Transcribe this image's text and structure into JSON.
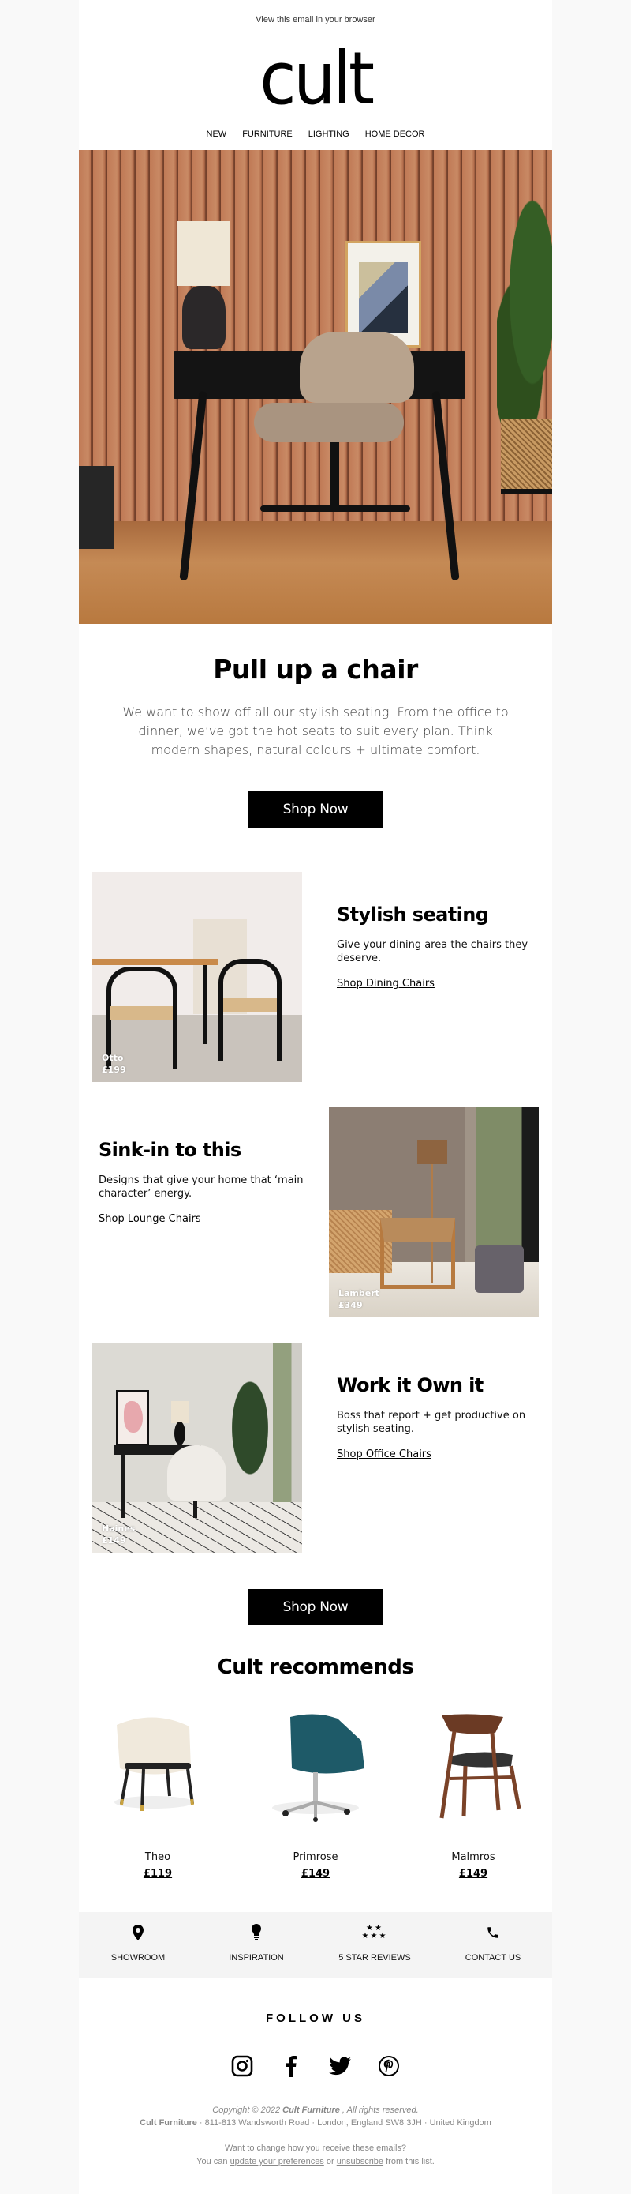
{
  "preheader": {
    "view_in_browser": "View this email in your browser"
  },
  "brand": {
    "logo_text": "cult"
  },
  "nav": {
    "items": [
      "NEW",
      "FURNITURE",
      "LIGHTING",
      "HOME DECOR"
    ]
  },
  "hero": {
    "alt": "Boucle office chair at black desk against wooden slat wall"
  },
  "intro": {
    "heading": "Pull up a chair",
    "body": "We want to show off all our stylish seating. From the office to dinner, we’ve got the hot seats to suit every plan. Think modern shapes, natural colours + ultimate comfort.",
    "cta": "Shop Now"
  },
  "features": [
    {
      "heading": "Stylish seating",
      "body": "Give your dining area the chairs they deserve.",
      "link": "Shop Dining Chairs",
      "product_name": "Otto",
      "product_price": "£199"
    },
    {
      "heading": "Sink-in to this",
      "body": "Designs that give your home that ‘main character’ energy.",
      "link": "Shop Lounge Chairs",
      "product_name": "Lambert",
      "product_price": "£349"
    },
    {
      "heading": "Work it Own it",
      "body": "Boss that report + get productive on stylish seating.",
      "link": "Shop Office Chairs",
      "product_name": "Haines",
      "product_price": "£149"
    }
  ],
  "cta2": {
    "label": "Shop Now"
  },
  "recommends": {
    "title": "Cult recommends",
    "items": [
      {
        "name": "Theo",
        "price": "£119"
      },
      {
        "name": "Primrose",
        "price": "£149"
      },
      {
        "name": "Malmros",
        "price": "£149"
      }
    ]
  },
  "quick_links": [
    {
      "label": "SHOWROOM",
      "icon": "map-pin-icon"
    },
    {
      "label": "INSPIRATION",
      "icon": "lightbulb-icon"
    },
    {
      "label": "5 STAR REVIEWS",
      "icon": "stars-icon"
    },
    {
      "label": "CONTACT US",
      "icon": "phone-icon"
    }
  ],
  "footer": {
    "follow_title": "FOLLOW US",
    "social": [
      "instagram-icon",
      "facebook-icon",
      "twitter-icon",
      "pinterest-icon"
    ],
    "copyright_prefix": "Copyright © 2022 ",
    "company": "Cult Furniture",
    "copyright_suffix": " , All rights reserved.",
    "address_company": "Cult Furniture",
    "address": " · 811-813 Wandsworth Road · London, England SW8 3JH · United Kingdom",
    "pref_question": "Want to change how you receive these emails?",
    "pref_prefix": "You can ",
    "update_link": "update your preferences",
    "pref_or": " or ",
    "unsubscribe_link": "unsubscribe",
    "pref_suffix": " from this list."
  },
  "colors": {
    "page_bg": "#f9f9f9",
    "button_bg": "#000000",
    "quick_bg": "#f4f4f4",
    "footer_text": "#888888"
  }
}
